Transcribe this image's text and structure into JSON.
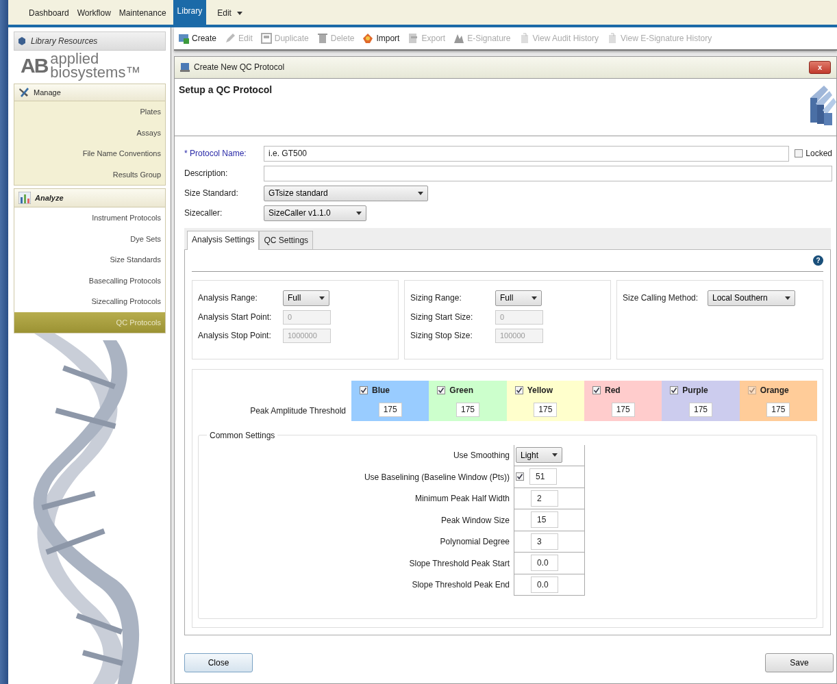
{
  "menu": [
    {
      "label": "Dashboard",
      "selected": false
    },
    {
      "label": "Workflow",
      "selected": false
    },
    {
      "label": "Maintenance",
      "selected": false
    },
    {
      "label": "Library",
      "selected": true
    },
    {
      "label": "Edit",
      "selected": false,
      "dropdown": true
    }
  ],
  "sidebar": {
    "header": "Library Resources",
    "logo": {
      "mark": "AB",
      "line1": "applied",
      "line2": "biosystems™"
    },
    "sections": [
      {
        "title": "Manage",
        "kind": "manage",
        "items": [
          {
            "label": "Plates",
            "selected": false
          },
          {
            "label": "Assays",
            "selected": false
          },
          {
            "label": "File Name Conventions",
            "selected": false
          },
          {
            "label": "Results Group",
            "selected": false
          }
        ]
      },
      {
        "title": "Analyze",
        "kind": "analyze",
        "items": [
          {
            "label": "Instrument Protocols",
            "selected": false
          },
          {
            "label": "Dye Sets",
            "selected": false
          },
          {
            "label": "Size Standards",
            "selected": false
          },
          {
            "label": "Basecalling Protocols",
            "selected": false
          },
          {
            "label": "Sizecalling Protocols",
            "selected": false
          },
          {
            "label": "QC Protocols",
            "selected": true
          }
        ]
      }
    ]
  },
  "toolbar": [
    {
      "label": "Create",
      "kind": "create",
      "disabled": false
    },
    {
      "label": "Edit",
      "kind": "edit",
      "disabled": true
    },
    {
      "label": "Duplicate",
      "kind": "duplicate",
      "disabled": true
    },
    {
      "label": "Delete",
      "kind": "delete",
      "disabled": true
    },
    {
      "label": "Import",
      "kind": "import",
      "disabled": false
    },
    {
      "label": "Export",
      "kind": "export",
      "disabled": true
    },
    {
      "label": "E-Signature",
      "kind": "signature",
      "disabled": true
    },
    {
      "label": "View Audit History",
      "kind": "history",
      "disabled": true
    },
    {
      "label": "View E-Signature History",
      "kind": "history",
      "disabled": true
    }
  ],
  "dialog": {
    "title": "Create New QC Protocol",
    "close": "x",
    "heading": "Setup a QC Protocol",
    "protocol_name": {
      "label": "* Protocol Name:",
      "placeholder": "i.e. GT500"
    },
    "locked": {
      "label": "Locked",
      "checked": false
    },
    "description": {
      "label": "Description:"
    },
    "size_standard": {
      "label": "Size Standard:",
      "value": "GTsize standard"
    },
    "sizecaller": {
      "label": "Sizecaller:",
      "value": "SizeCaller v1.1.0"
    },
    "tabs": [
      {
        "label": "Analysis Settings",
        "selected": true
      },
      {
        "label": "QC Settings",
        "selected": false
      }
    ],
    "help": "?",
    "range_groups": [
      {
        "rows": [
          {
            "label": "Analysis Range:",
            "kind": "select",
            "value": "Full"
          },
          {
            "label": "Analysis Start Point:",
            "kind": "readonly",
            "value": "0"
          },
          {
            "label": "Analysis Stop Point:",
            "kind": "readonly",
            "value": "1000000"
          }
        ]
      },
      {
        "rows": [
          {
            "label": "Sizing Range:",
            "kind": "select",
            "value": "Full"
          },
          {
            "label": "Sizing Start Size:",
            "kind": "readonly",
            "value": "0"
          },
          {
            "label": "Sizing Stop Size:",
            "kind": "readonly",
            "value": "100000"
          }
        ]
      },
      {
        "rows": [
          {
            "label": "Size Calling Method:",
            "kind": "select",
            "value": "Local Southern"
          }
        ]
      }
    ],
    "threshold_label": "Peak Amplitude Threshold",
    "dyes": [
      {
        "name": "Blue",
        "checked": true,
        "disabled": false,
        "color": "#99ccff",
        "value": "175"
      },
      {
        "name": "Green",
        "checked": true,
        "disabled": false,
        "color": "#ccffcc",
        "value": "175"
      },
      {
        "name": "Yellow",
        "checked": true,
        "disabled": false,
        "color": "#ffffcc",
        "value": "175"
      },
      {
        "name": "Red",
        "checked": true,
        "disabled": false,
        "color": "#ffcccc",
        "value": "175"
      },
      {
        "name": "Purple",
        "checked": true,
        "disabled": false,
        "color": "#ccccee",
        "value": "175"
      },
      {
        "name": "Orange",
        "checked": true,
        "disabled": true,
        "color": "#ffcc99",
        "value": "175"
      }
    ],
    "common_title": "Common Settings",
    "common": [
      {
        "label": "Use Smoothing",
        "kind": "select",
        "value": "Light"
      },
      {
        "label": "Use Baselining (Baseline Window (Pts))",
        "kind": "checknum",
        "checked": true,
        "value": "51"
      },
      {
        "label": "Minimum Peak Half Width",
        "kind": "number",
        "value": "2"
      },
      {
        "label": "Peak Window Size",
        "kind": "number",
        "value": "15"
      },
      {
        "label": "Polynomial Degree",
        "kind": "number",
        "value": "3"
      },
      {
        "label": "Slope Threshold Peak Start",
        "kind": "number",
        "value": "0.0"
      },
      {
        "label": "Slope Threshold Peak End",
        "kind": "number",
        "value": "0.0"
      }
    ],
    "buttons": [
      {
        "label": "Close"
      },
      {
        "label": "Save"
      }
    ]
  }
}
